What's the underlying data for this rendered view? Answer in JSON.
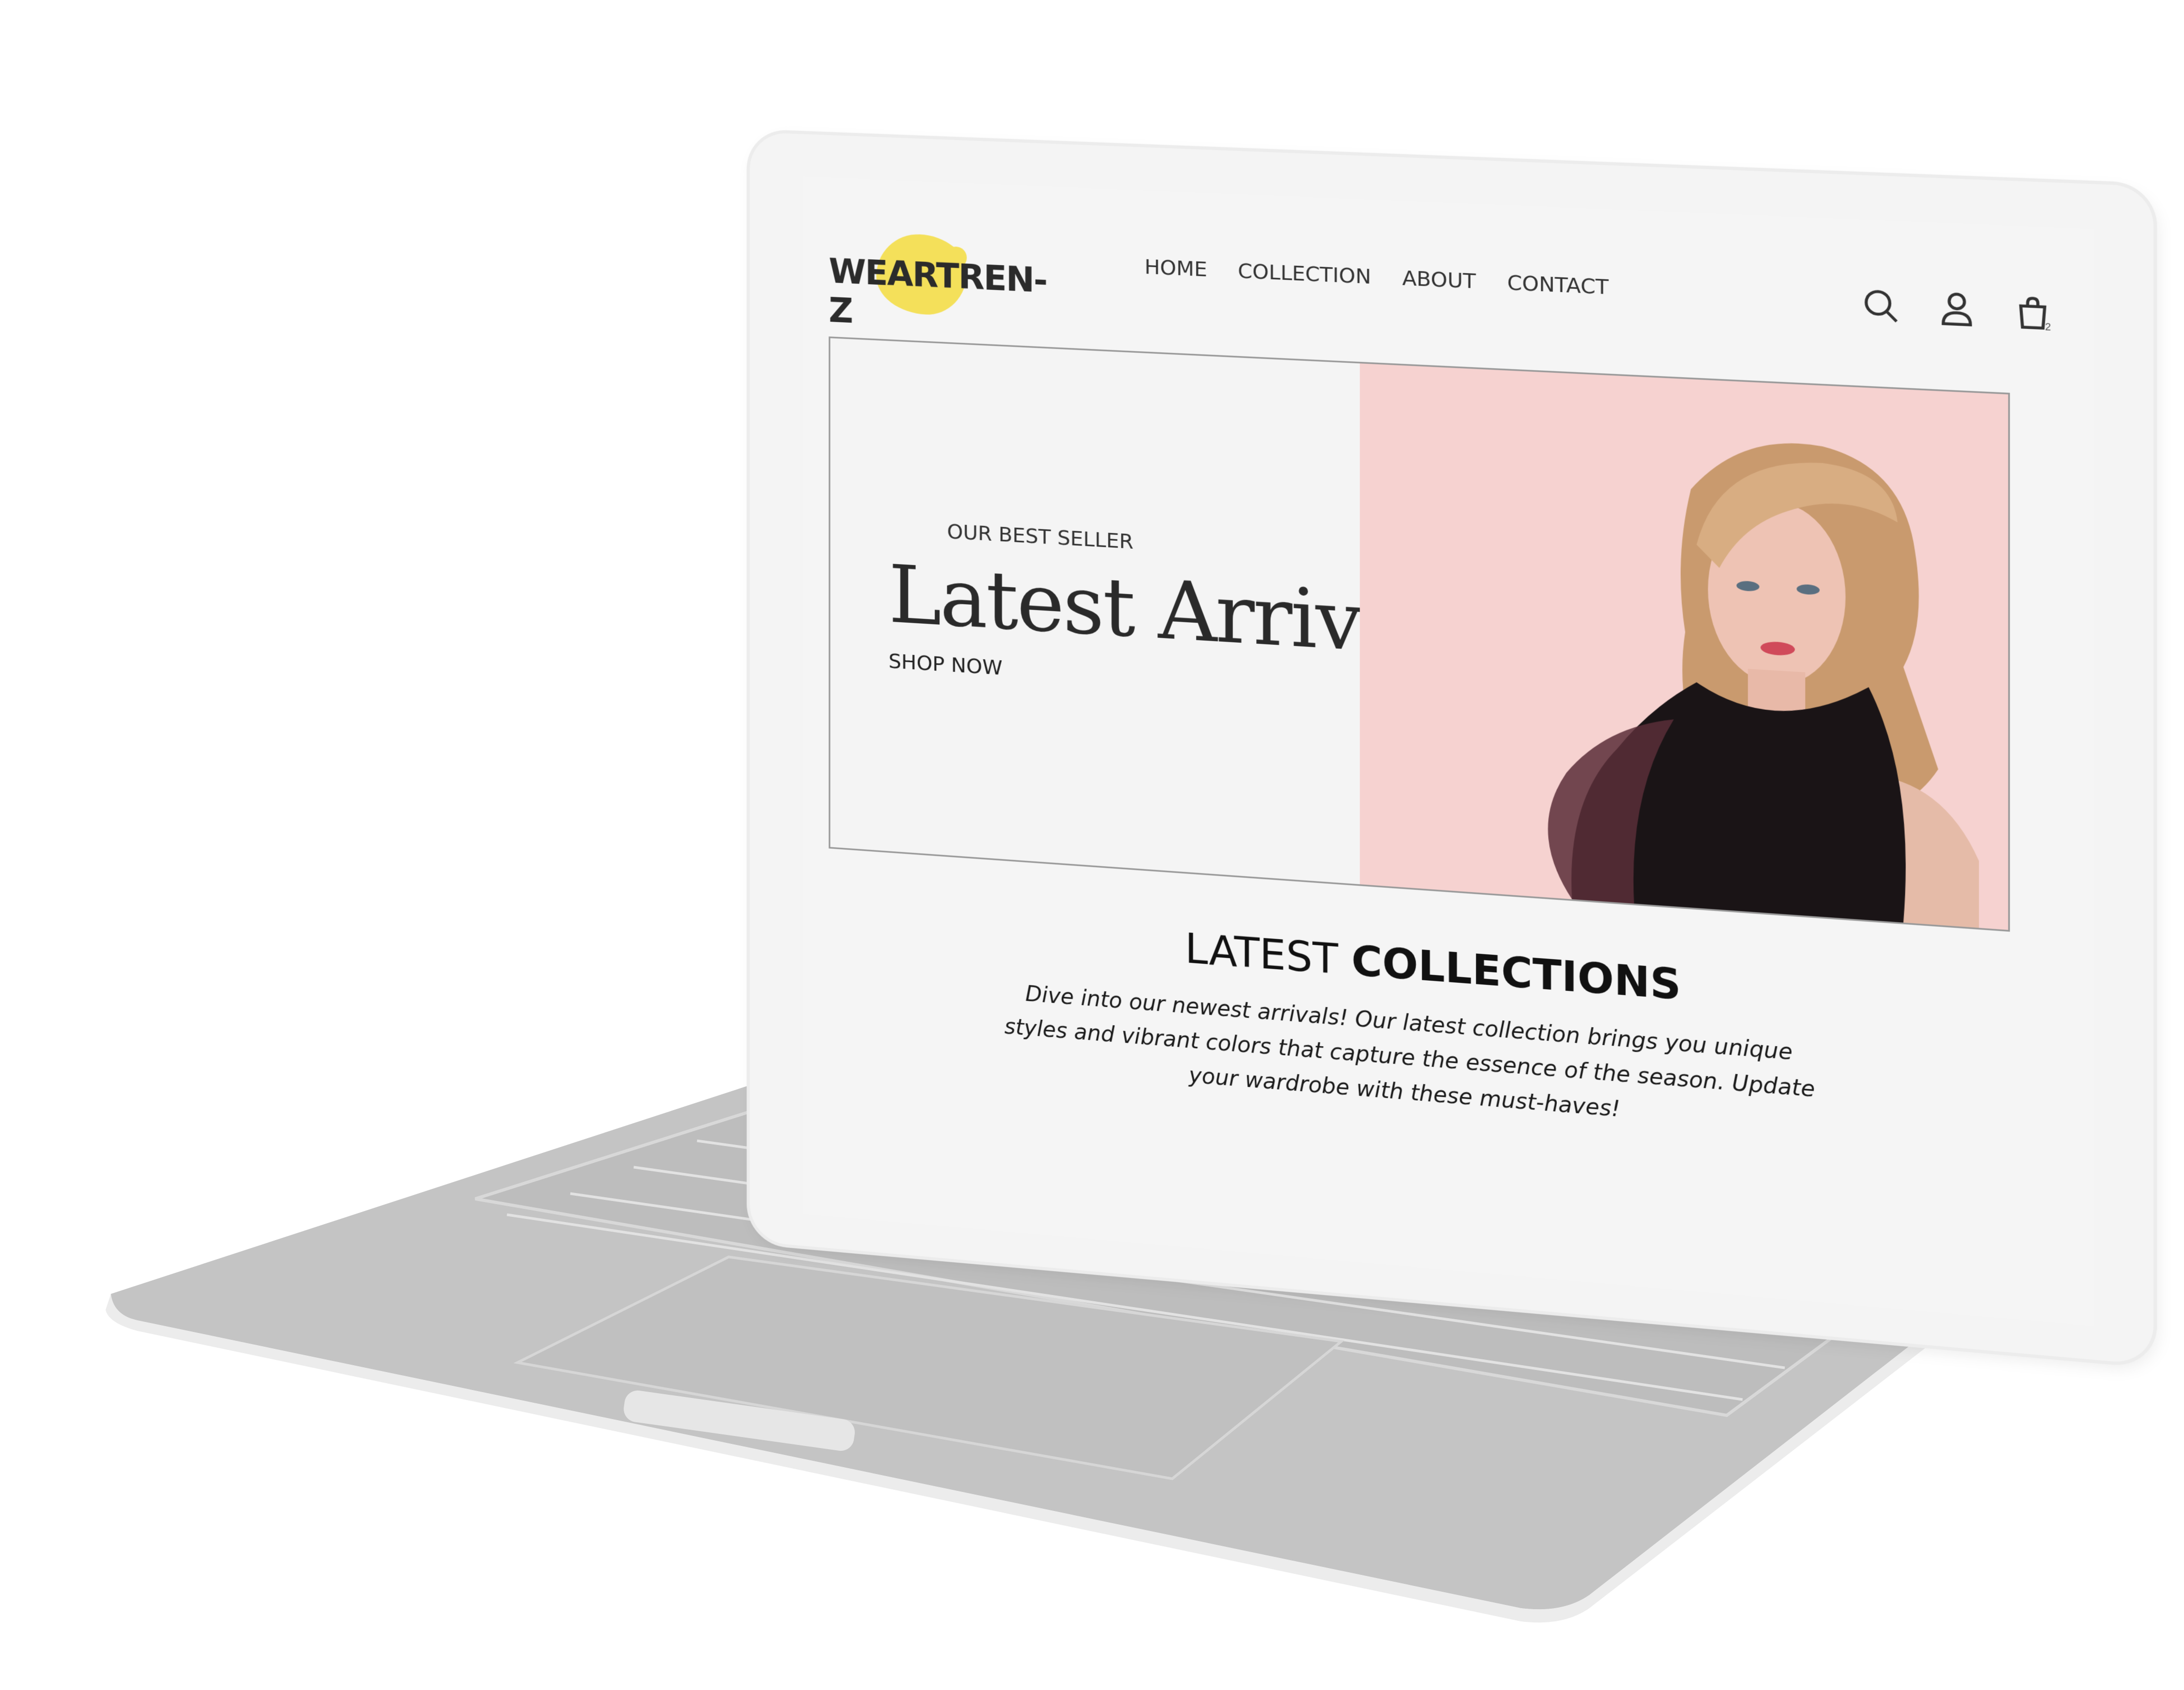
{
  "brand": {
    "logo_text": "WEARTREN-Z",
    "accent_color": "#f4e05a"
  },
  "nav": {
    "items": [
      "HOME",
      "COLLECTION",
      "ABOUT",
      "CONTACT"
    ]
  },
  "header_icons": {
    "search": "search-icon",
    "account": "user-icon",
    "cart": "cart-icon",
    "cart_count": "2"
  },
  "hero": {
    "eyebrow": "OUR BEST SELLER",
    "title": "Latest Arrivals",
    "cta": "SHOP NOW",
    "image_bg": "#f6d2d0"
  },
  "latest": {
    "title_light": "LATEST",
    "title_bold": "COLLECTIONS",
    "description": "Dive into our newest arrivals! Our latest collection brings you unique styles and vibrant colors that capture the essence of the season. Update your wardrobe with these must-haves!"
  }
}
